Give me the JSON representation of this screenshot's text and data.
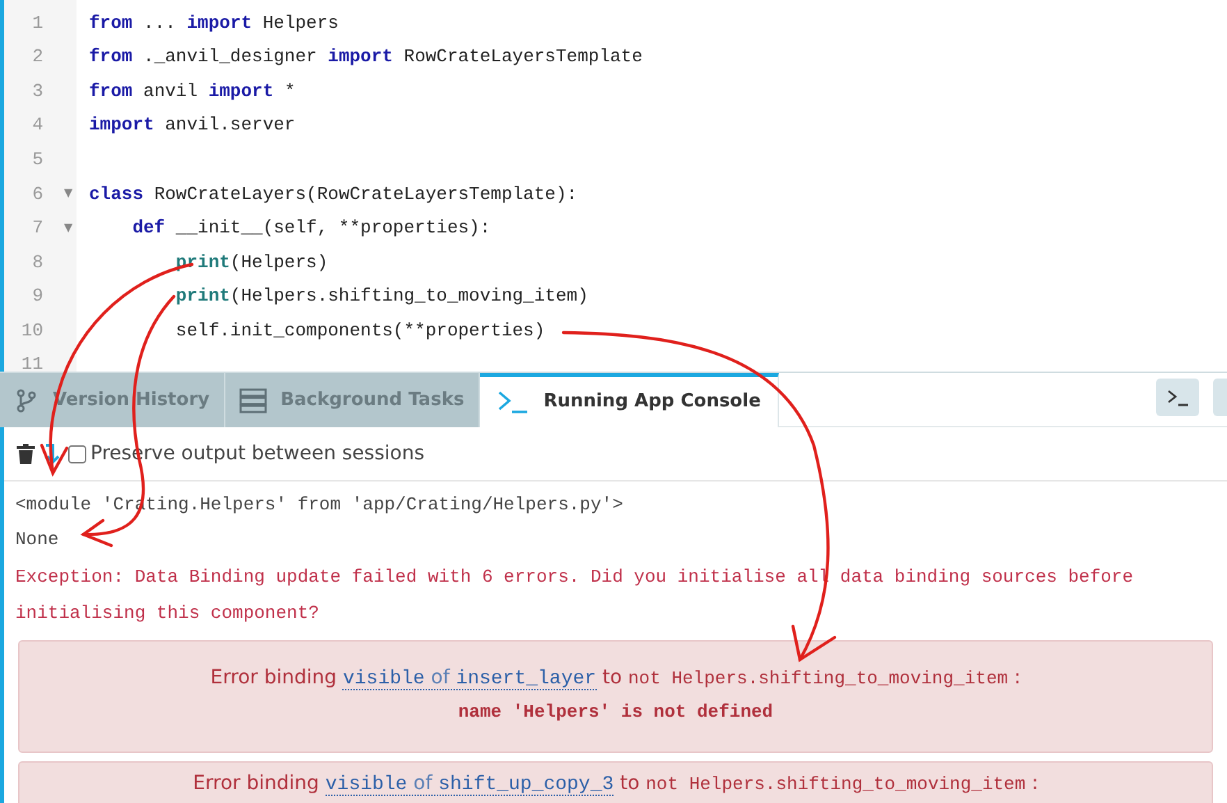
{
  "editor": {
    "lines": [
      {
        "number": "1",
        "tokens": [
          {
            "text": "from",
            "kind": "keyword"
          },
          {
            "text": " ... ",
            "kind": "plain"
          },
          {
            "text": "import",
            "kind": "keyword"
          },
          {
            "text": " Helpers",
            "kind": "plain"
          }
        ]
      },
      {
        "number": "2",
        "tokens": [
          {
            "text": "from",
            "kind": "keyword"
          },
          {
            "text": " ._anvil_designer ",
            "kind": "plain"
          },
          {
            "text": "import",
            "kind": "keyword"
          },
          {
            "text": " RowCrateLayersTemplate",
            "kind": "plain"
          }
        ]
      },
      {
        "number": "3",
        "tokens": [
          {
            "text": "from",
            "kind": "keyword"
          },
          {
            "text": " anvil ",
            "kind": "plain"
          },
          {
            "text": "import",
            "kind": "keyword"
          },
          {
            "text": " *",
            "kind": "plain"
          }
        ]
      },
      {
        "number": "4",
        "tokens": [
          {
            "text": "import",
            "kind": "keyword"
          },
          {
            "text": " anvil.server",
            "kind": "plain"
          }
        ]
      },
      {
        "number": "5"
      },
      {
        "number": "6",
        "fold_marker": "▼",
        "tokens": [
          {
            "text": "class",
            "kind": "keyword"
          },
          {
            "text": " RowCrateLayers(RowCrateLayersTemplate):",
            "kind": "plain"
          }
        ]
      },
      {
        "number": "7",
        "fold_marker": "▼",
        "tokens": [
          {
            "text": "    def",
            "kind": "keyword"
          },
          {
            "text": " __init__(self, **properties):",
            "kind": "plain"
          }
        ]
      },
      {
        "number": "8",
        "tokens": [
          {
            "text": "        print",
            "kind": "builtin"
          },
          {
            "text": "(Helpers)",
            "kind": "plain"
          }
        ]
      },
      {
        "number": "9",
        "tokens": [
          {
            "text": "        print",
            "kind": "builtin"
          },
          {
            "text": "(Helpers.shifting_to_moving_item)",
            "kind": "plain"
          }
        ]
      },
      {
        "number": "10",
        "tokens": [
          {
            "text": "        self.init_components(**properties)",
            "kind": "plain"
          }
        ]
      },
      {
        "number": "11"
      }
    ]
  },
  "tabs": [
    {
      "label": "Version History",
      "selected": false
    },
    {
      "label": "Background Tasks",
      "selected": false
    },
    {
      "label": "Running App Console",
      "selected": true
    }
  ],
  "toolbar": {
    "preserve": {
      "label": "Preserve output between sessions",
      "checked": false
    }
  },
  "console": [
    {
      "kind": "log",
      "text": "<module 'Crating.Helpers' from 'app/Crating/Helpers.py'>"
    },
    {
      "kind": "log",
      "text": "None"
    },
    {
      "kind": "exception",
      "text": "Exception: Data Binding update failed with 6 errors. Did you initialise all data binding sources before initialising this component?"
    },
    {
      "kind": "binding_error",
      "prefix": "Error binding",
      "property": "visible",
      "of": "of",
      "component": "insert_layer",
      "to": "to",
      "expression": "not Helpers.shifting_to_moving_item",
      "colon": ":",
      "message": "name 'Helpers' is not defined"
    },
    {
      "kind": "binding_error",
      "prefix": "Error binding",
      "property": "visible",
      "of": "of",
      "component": "shift_up_copy_3",
      "to": "to",
      "expression": "not Helpers.shifting_to_moving_item",
      "colon": ":"
    }
  ]
}
